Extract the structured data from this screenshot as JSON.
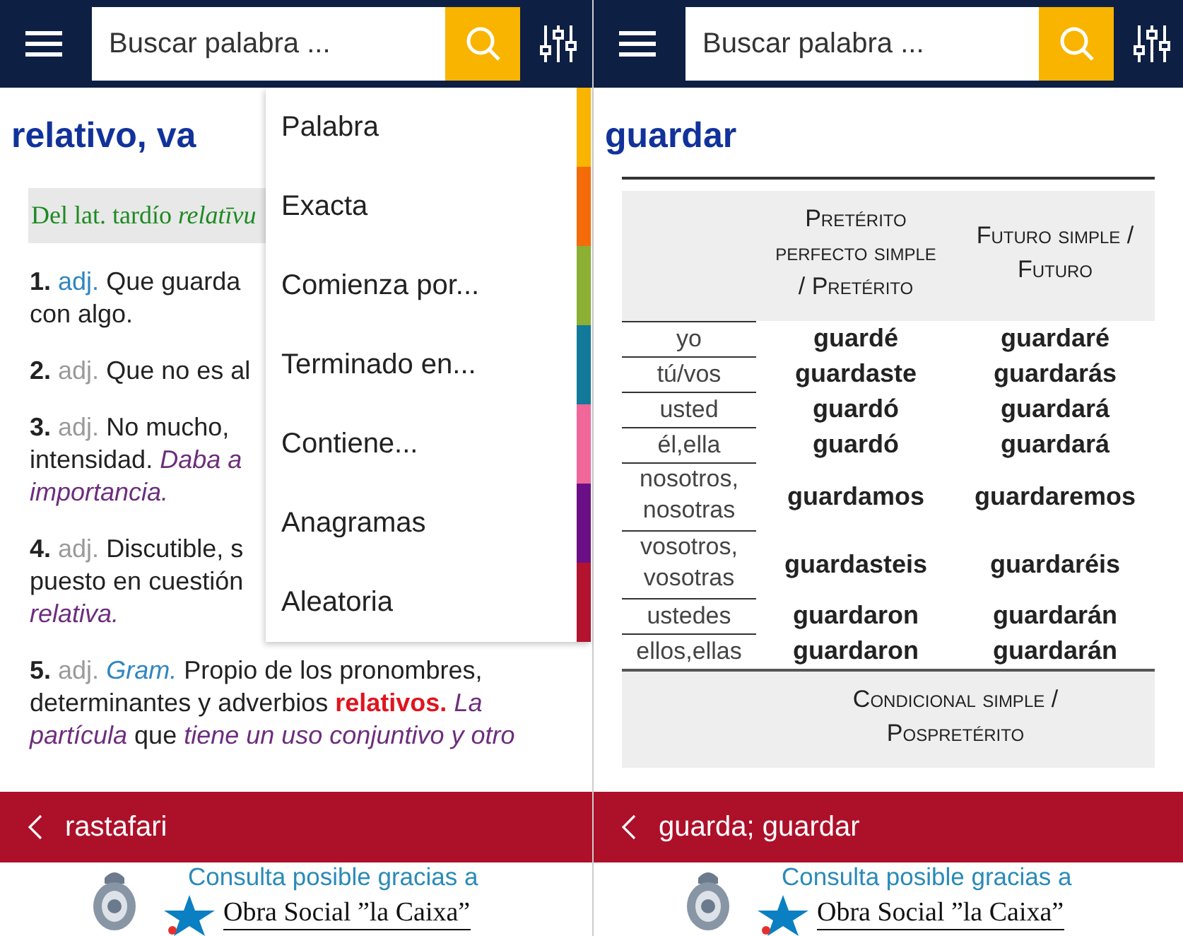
{
  "panels": [
    {
      "search": {
        "placeholder": "Buscar palabra ..."
      },
      "entry": {
        "kind": "definition",
        "title": "relativo, va",
        "etymology": "Del lat. tardío *relatīvu*",
        "definitions": [
          {
            "number": "1.",
            "abbr": "adj.",
            "abbr_link": true,
            "lines": [
              "Que guarda",
              "con algo."
            ]
          },
          {
            "number": "2.",
            "abbr": "adj.",
            "abbr_link": false,
            "lines": [
              "Que no es al"
            ]
          },
          {
            "number": "3.",
            "abbr": "adj.",
            "abbr_link": false,
            "lines": [
              "No mucho,",
              "intensidad. *Daba a*",
              "*importancia.*"
            ]
          },
          {
            "number": "4.",
            "abbr": "adj.",
            "abbr_link": false,
            "lines": [
              "Discutible, s",
              "puesto en cuestión",
              "*relativa.*"
            ]
          },
          {
            "number": "5.",
            "abbr": "adj.",
            "abbr_link": false,
            "tag": "Gram.",
            "lines": [
              "Propio de los pronombres,",
              "determinantes y adverbios **relativos.** *La*",
              "*partícula* que *tiene un uso conjuntivo y otro*"
            ]
          }
        ]
      },
      "menu": {
        "items": [
          {
            "label": "Palabra",
            "color": "#f9b400"
          },
          {
            "label": "Exacta",
            "color": "#f56b0a"
          },
          {
            "label": "Comienza por...",
            "color": "#8bb033"
          },
          {
            "label": "Terminado en...",
            "color": "#12799a"
          },
          {
            "label": "Contiene...",
            "color": "#f2679a"
          },
          {
            "label": "Anagramas",
            "color": "#6b0f86"
          },
          {
            "label": "Aleatoria",
            "color": "#b3132f"
          }
        ]
      },
      "history": "rastafari",
      "footer": {
        "text": "Consulta posible gracias a",
        "sponsor": "Obra Social ”la Caixa”"
      }
    },
    {
      "search": {
        "placeholder": "Buscar palabra ..."
      },
      "entry": {
        "kind": "conjugation",
        "title": "guardar",
        "headers": [
          "Pretérito perfecto simple / Pretérito",
          "Futuro simple / Futuro"
        ],
        "rows": [
          {
            "person": "yo",
            "col_1": "guardé",
            "col_2": "guardaré"
          },
          {
            "person": "tú/vos",
            "col_1": "guardaste",
            "col_2": "guardarás"
          },
          {
            "person": "usted",
            "col_1": "guardó",
            "col_2": "guardará"
          },
          {
            "person": "él,ella",
            "col_1": "guardó",
            "col_2": "guardará"
          },
          {
            "person": "nosotros, nosotras",
            "col_1": "guardamos",
            "col_2": "guardaremos"
          },
          {
            "person": "vosotros, vosotras",
            "col_1": "guardasteis",
            "col_2": "guardaréis"
          },
          {
            "person": "ustedes",
            "col_1": "guardaron",
            "col_2": "guardarán"
          },
          {
            "person": "ellos,ellas",
            "col_1": "guardaron",
            "col_2": "guardarán"
          }
        ],
        "next_header": "Condicional simple / Pospretérito"
      },
      "history": "guarda; guardar",
      "footer": {
        "text": "Consulta posible gracias a",
        "sponsor": "Obra Social ”la Caixa”"
      }
    }
  ]
}
